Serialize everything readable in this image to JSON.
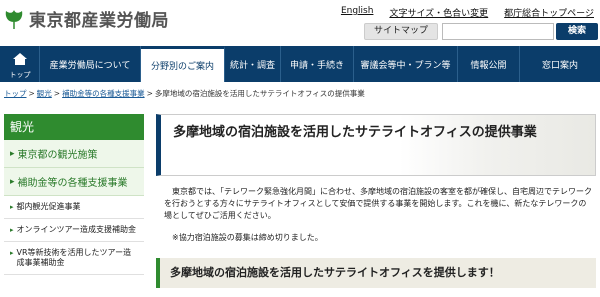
{
  "header": {
    "logo_text": "東京都産業労働局",
    "links": [
      "English",
      "文字サイズ・色合い変更",
      "都庁総合トップページ"
    ],
    "sitemap_label": "サイトマップ",
    "search_value": "",
    "search_placeholder": "",
    "search_button": "検索"
  },
  "nav": {
    "home_label": "トップ",
    "items": [
      "産業労働局について",
      "分野別のご案内",
      "統計・調査",
      "申請・手続き",
      "審議会等中・プラン等",
      "情報公開",
      "窓口案内"
    ]
  },
  "breadcrumb": {
    "items": [
      "トップ",
      "観光",
      "補助金等の各種支援事業"
    ],
    "current": "多摩地域の宿泊施設を活用したサテライトオフィスの提供事業",
    "separator": ">"
  },
  "sidebar": {
    "title": "観光",
    "sections": [
      "東京都の観光施策",
      "補助金等の各種支援事業"
    ],
    "subitems": [
      "都内観光促進事業",
      "オンラインツアー造成支援補助金",
      "VR等新技術を活用したツアー造成事業補助金"
    ]
  },
  "main": {
    "title": "多摩地域の宿泊施設を活用したサテライトオフィスの提供事業",
    "intro": "東京都では、「テレワーク緊急強化月間」に合わせ、多摩地域の宿泊施設の客室を都が確保し、自宅周辺でテレワークを行おうとする方々にサテライトオフィスとして安価で提供する事業を開始します。これを機に、新たなテレワークの場としてぜひご活用ください。",
    "note": "※協力宿泊施設の募集は締め切りました。",
    "section_heading": "多摩地域の宿泊施設を活用したサテライトオフィスを提供します！"
  },
  "colors": {
    "nav_bg": "#0b3d6a",
    "accent_green": "#2f8b2f",
    "link_blue": "#1a5a96"
  }
}
